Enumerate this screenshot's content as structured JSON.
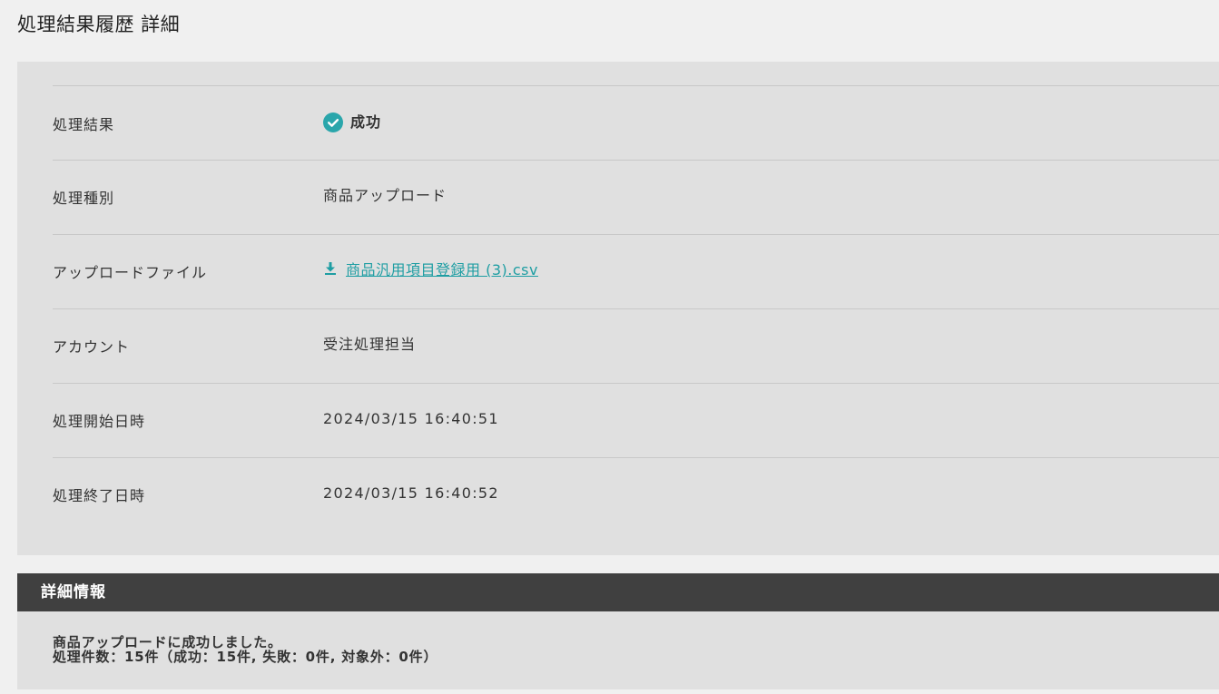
{
  "page": {
    "title": "処理結果履歴 詳細"
  },
  "details": {
    "result": {
      "label": "処理結果",
      "value": "成功",
      "icon": "check-circle-icon",
      "color": "#2aa6ab"
    },
    "type": {
      "label": "処理種別",
      "value": "商品アップロード"
    },
    "upload_file": {
      "label": "アップロードファイル",
      "value": "商品汎用項目登録用 (3).csv",
      "icon": "download-icon",
      "color": "#1f9ea3"
    },
    "account": {
      "label": "アカウント",
      "value": "受注処理担当"
    },
    "start_time": {
      "label": "処理開始日時",
      "value": "2024/03/15 16:40:51"
    },
    "end_time": {
      "label": "処理終了日時",
      "value": "2024/03/15 16:40:52"
    }
  },
  "info": {
    "header": "詳細情報",
    "message_line1": "商品アップロードに成功しました。",
    "message_line2": "処理件数：15件（成功：15件, 失敗：0件, 対象外：0件）"
  },
  "colors": {
    "background": "#f0f0f0",
    "panel": "#e0e0e0",
    "header_bar": "#404040",
    "accent": "#1f9ea3"
  }
}
